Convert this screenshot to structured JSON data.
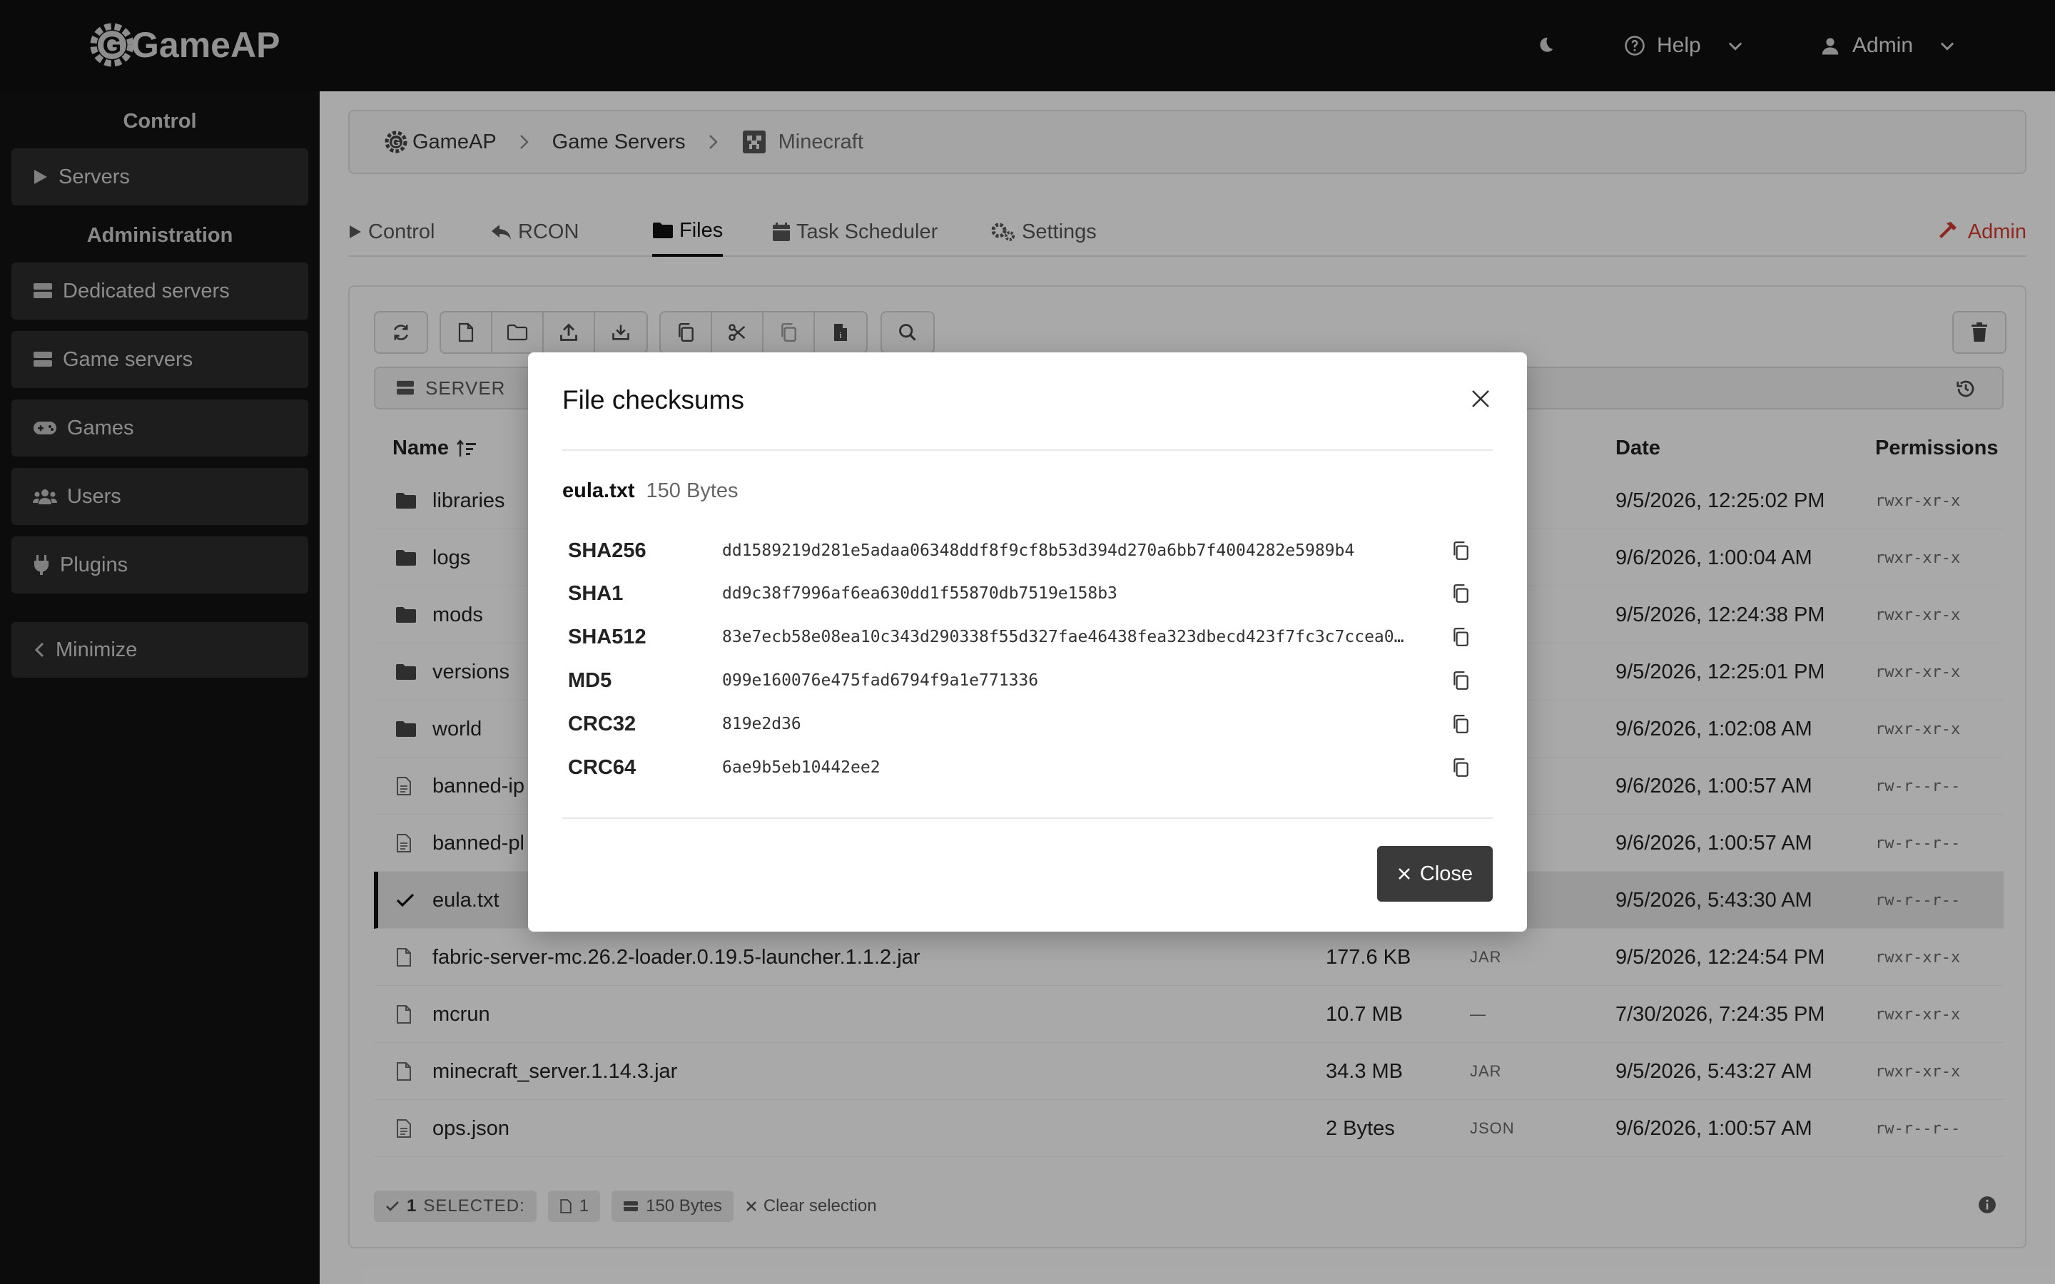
{
  "app": {
    "logo_text": "GameAP"
  },
  "topbar": {
    "help_label": "Help",
    "user_label": "Admin"
  },
  "sidebar": {
    "control_heading": "Control",
    "admin_heading": "Administration",
    "items": [
      {
        "label": "Servers",
        "icon": "play-icon"
      },
      {
        "label": "Dedicated servers",
        "icon": "server-icon"
      },
      {
        "label": "Game servers",
        "icon": "server-icon"
      },
      {
        "label": "Games",
        "icon": "gamepad-icon"
      },
      {
        "label": "Users",
        "icon": "users-icon"
      },
      {
        "label": "Plugins",
        "icon": "plug-icon"
      }
    ],
    "minimize_label": "Minimize"
  },
  "breadcrumb": {
    "items": [
      "GameAP",
      "Game Servers",
      "Minecraft"
    ]
  },
  "tabs": {
    "items": [
      "Control",
      "RCON",
      "Files",
      "Task Scheduler",
      "Settings"
    ],
    "active": "Files",
    "admin_label": "Admin",
    "admin_color": "#d23a2f"
  },
  "files": {
    "path_label": "SERVER",
    "columns": {
      "name": "Name",
      "date": "Date",
      "permissions": "Permissions"
    },
    "rows": [
      {
        "name": "libraries",
        "kind": "folder",
        "size": "",
        "type": "",
        "date": "9/5/2026, 12:25:02 PM",
        "perm": "rwxr-xr-x"
      },
      {
        "name": "logs",
        "kind": "folder",
        "size": "",
        "type": "",
        "date": "9/6/2026, 1:00:04 AM",
        "perm": "rwxr-xr-x"
      },
      {
        "name": "mods",
        "kind": "folder",
        "size": "",
        "type": "",
        "date": "9/5/2026, 12:24:38 PM",
        "perm": "rwxr-xr-x"
      },
      {
        "name": "versions",
        "kind": "folder",
        "size": "",
        "type": "",
        "date": "9/5/2026, 12:25:01 PM",
        "perm": "rwxr-xr-x"
      },
      {
        "name": "world",
        "kind": "folder",
        "size": "",
        "type": "",
        "date": "9/6/2026, 1:02:08 AM",
        "perm": "rwxr-xr-x"
      },
      {
        "name": "banned-ip",
        "kind": "file-text",
        "size": "",
        "type": "",
        "date": "9/6/2026, 1:00:57 AM",
        "perm": "rw-r--r--"
      },
      {
        "name": "banned-pl",
        "kind": "file-text",
        "size": "",
        "type": "",
        "date": "9/6/2026, 1:00:57 AM",
        "perm": "rw-r--r--"
      },
      {
        "name": "eula.txt",
        "kind": "check",
        "size": "",
        "type": "",
        "date": "9/5/2026, 5:43:30 AM",
        "perm": "rw-r--r--"
      },
      {
        "name": "fabric-server-mc.26.2-loader.0.19.5-launcher.1.1.2.jar",
        "kind": "file",
        "size": "177.6 KB",
        "type": "JAR",
        "date": "9/5/2026, 12:24:54 PM",
        "perm": "rwxr-xr-x"
      },
      {
        "name": "mcrun",
        "kind": "file",
        "size": "10.7 MB",
        "type": "—",
        "date": "7/30/2026, 7:24:35 PM",
        "perm": "rwxr-xr-x"
      },
      {
        "name": "minecraft_server.1.14.3.jar",
        "kind": "file",
        "size": "34.3 MB",
        "type": "JAR",
        "date": "9/5/2026, 5:43:27 AM",
        "perm": "rwxr-xr-x"
      },
      {
        "name": "ops.json",
        "kind": "file-text",
        "size": "2 Bytes",
        "type": "JSON",
        "date": "9/6/2026, 1:00:57 AM",
        "perm": "rw-r--r--"
      }
    ],
    "footer": {
      "selected_count": "1",
      "selected_label": "SELECTED:",
      "file_count": "1",
      "total_size": "150 Bytes",
      "clear_label": "Clear selection"
    }
  },
  "modal": {
    "title": "File checksums",
    "file_name": "eula.txt",
    "file_size": "150 Bytes",
    "hashes": [
      {
        "alg": "SHA256",
        "value": "dd1589219d281e5adaa06348ddf8f9cf8b53d394d270a6bb7f4004282e5989b4"
      },
      {
        "alg": "SHA1",
        "value": "dd9c38f7996af6ea630dd1f55870db7519e158b3"
      },
      {
        "alg": "SHA512",
        "value": "83e7ecb58e08ea10c343d290338f55d327fae46438fea323dbecd423f7fc3c7ccea0…"
      },
      {
        "alg": "MD5",
        "value": "099e160076e475fad6794f9a1e771336"
      },
      {
        "alg": "CRC32",
        "value": "819e2d36"
      },
      {
        "alg": "CRC64",
        "value": "6ae9b5eb10442ee2"
      }
    ],
    "close_label": "Close"
  }
}
